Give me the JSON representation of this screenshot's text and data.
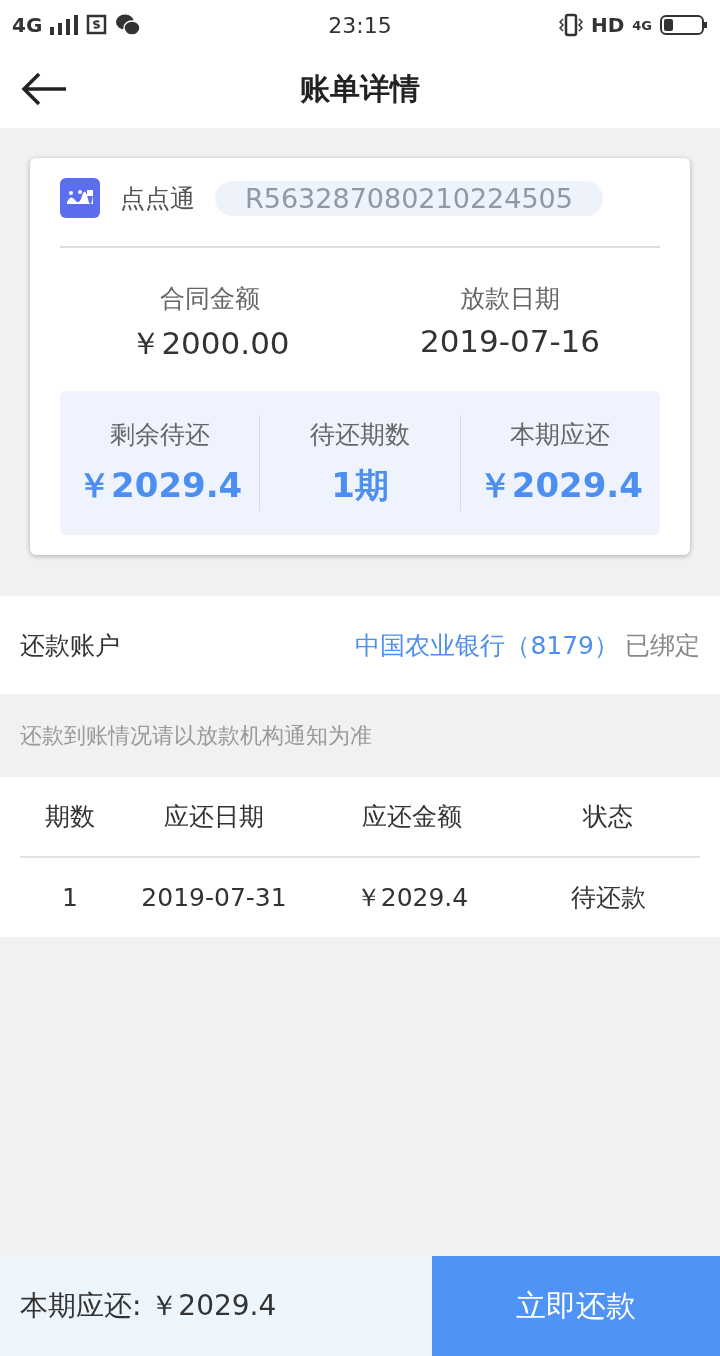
{
  "status_bar": {
    "network": "4G",
    "time": "23:15",
    "hd": "HD",
    "network_right": "4G"
  },
  "header": {
    "title": "账单详情"
  },
  "card": {
    "lender": "点点通",
    "contract_no": "R563287080210224505",
    "info": [
      {
        "label": "合同金额",
        "value": "￥2000.00"
      },
      {
        "label": "放款日期",
        "value": "2019-07-16"
      }
    ],
    "summary": [
      {
        "label": "剩余待还",
        "value": "￥2029.4"
      },
      {
        "label": "待还期数",
        "value": "1期"
      },
      {
        "label": "本期应还",
        "value": "￥2029.4"
      }
    ]
  },
  "account": {
    "label": "还款账户",
    "bank": "中国农业银行（8179）",
    "status": "已绑定"
  },
  "notice": "还款到账情况请以放款机构通知为准",
  "table": {
    "columns": [
      "期数",
      "应还日期",
      "应还金额",
      "状态"
    ],
    "rows": [
      [
        "1",
        "2019-07-31",
        "￥2029.4",
        "待还款"
      ]
    ]
  },
  "footer": {
    "due": "本期应还: ￥2029.4",
    "button": "立即还款"
  }
}
